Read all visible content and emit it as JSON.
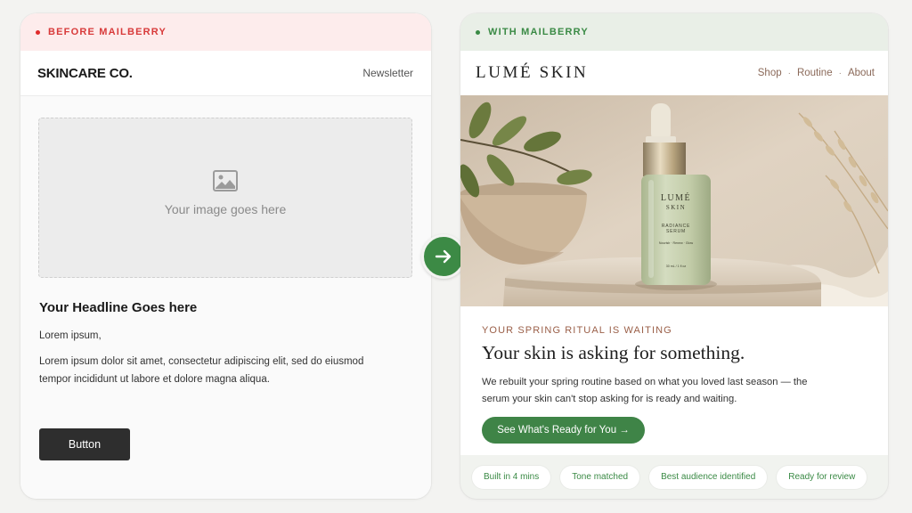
{
  "before": {
    "banner": "BEFORE MAILBERRY",
    "brand": "SKINCARE CO.",
    "nav": "Newsletter",
    "placeholder": {
      "icon": "image-icon",
      "text": "Your image goes here"
    },
    "headline": "Your Headline Goes here",
    "greeting": "Lorem ipsum,",
    "paragraph": "Lorem ipsum dolor sit amet, consectetur adipiscing elit, sed do eiusmod tempor incididunt ut labore et dolore magna aliqua.",
    "button": "Button"
  },
  "arrow": {
    "icon": "arrow-right-icon",
    "color": "#3c8a45"
  },
  "after": {
    "banner": "WITH MAILBERRY",
    "brand": "LUMÉ SKIN",
    "nav": [
      "Shop",
      "Routine",
      "About"
    ],
    "hero": {
      "bottle_brand_line1": "LUMÉ",
      "bottle_brand_line2": "SKIN",
      "bottle_product_line1": "RADIANCE",
      "bottle_product_line2": "SERUM",
      "bottle_tagline": "Nourish · Renew · Glow",
      "bottle_volume": "30 mL / 1 fl oz"
    },
    "eyebrow": "YOUR SPRING RITUAL IS WAITING",
    "headline": "Your skin is asking for something.",
    "paragraph": "We rebuilt your spring routine based on what you loved last season — the serum your skin can't stop asking for is ready and waiting.",
    "cta": "See What's Ready for You →",
    "chips": [
      "Built in 4 mins",
      "Tone matched",
      "Best audience identified",
      "Ready for review"
    ]
  },
  "colors": {
    "accent_green": "#3f8447",
    "before_red": "#d83a3a",
    "eyebrow_brown": "#9a5f48"
  }
}
